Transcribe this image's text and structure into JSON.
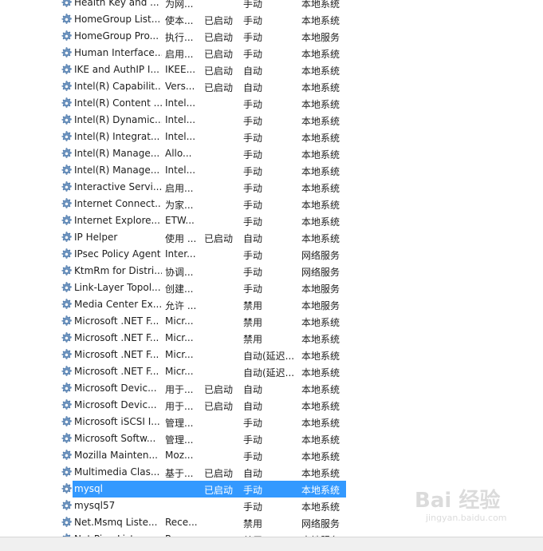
{
  "services": [
    {
      "name": "Health Key and ...",
      "desc": "为网...",
      "status": "",
      "startup": "手动",
      "logon": "本地系统"
    },
    {
      "name": "HomeGroup List...",
      "desc": "使本...",
      "status": "已启动",
      "startup": "手动",
      "logon": "本地系统"
    },
    {
      "name": "HomeGroup Pro...",
      "desc": "执行...",
      "status": "已启动",
      "startup": "手动",
      "logon": "本地服务"
    },
    {
      "name": "Human Interface...",
      "desc": "启用...",
      "status": "已启动",
      "startup": "手动",
      "logon": "本地系统"
    },
    {
      "name": "IKE and AuthIP I...",
      "desc": "IKEE...",
      "status": "已启动",
      "startup": "自动",
      "logon": "本地系统"
    },
    {
      "name": "Intel(R) Capabilit...",
      "desc": "Vers...",
      "status": "已启动",
      "startup": "自动",
      "logon": "本地系统"
    },
    {
      "name": "Intel(R) Content ...",
      "desc": "Intel...",
      "status": "",
      "startup": "手动",
      "logon": "本地系统"
    },
    {
      "name": "Intel(R) Dynamic...",
      "desc": "Intel...",
      "status": "",
      "startup": "手动",
      "logon": "本地系统"
    },
    {
      "name": "Intel(R) Integrat...",
      "desc": "Intel...",
      "status": "",
      "startup": "手动",
      "logon": "本地系统"
    },
    {
      "name": "Intel(R) Manage...",
      "desc": "Allo...",
      "status": "",
      "startup": "手动",
      "logon": "本地系统"
    },
    {
      "name": "Intel(R) Manage...",
      "desc": "Intel...",
      "status": "",
      "startup": "手动",
      "logon": "本地系统"
    },
    {
      "name": "Interactive Servi...",
      "desc": "启用...",
      "status": "",
      "startup": "手动",
      "logon": "本地系统"
    },
    {
      "name": "Internet Connect...",
      "desc": "为家...",
      "status": "",
      "startup": "手动",
      "logon": "本地系统"
    },
    {
      "name": "Internet Explore...",
      "desc": "ETW...",
      "status": "",
      "startup": "手动",
      "logon": "本地系统"
    },
    {
      "name": "IP Helper",
      "desc": "使用 ...",
      "status": "已启动",
      "startup": "自动",
      "logon": "本地系统"
    },
    {
      "name": "IPsec Policy Agent",
      "desc": "Inter...",
      "status": "",
      "startup": "手动",
      "logon": "网络服务"
    },
    {
      "name": "KtmRm for Distri...",
      "desc": "协调...",
      "status": "",
      "startup": "手动",
      "logon": "网络服务"
    },
    {
      "name": "Link-Layer Topol...",
      "desc": "创建...",
      "status": "",
      "startup": "手动",
      "logon": "本地服务"
    },
    {
      "name": "Media Center Ex...",
      "desc": "允许 ...",
      "status": "",
      "startup": "禁用",
      "logon": "本地服务"
    },
    {
      "name": "Microsoft .NET F...",
      "desc": "Micr...",
      "status": "",
      "startup": "禁用",
      "logon": "本地系统"
    },
    {
      "name": "Microsoft .NET F...",
      "desc": "Micr...",
      "status": "",
      "startup": "禁用",
      "logon": "本地系统"
    },
    {
      "name": "Microsoft .NET F...",
      "desc": "Micr...",
      "status": "",
      "startup": "自动(延迟...",
      "logon": "本地系统"
    },
    {
      "name": "Microsoft .NET F...",
      "desc": "Micr...",
      "status": "",
      "startup": "自动(延迟...",
      "logon": "本地系统"
    },
    {
      "name": "Microsoft Devic...",
      "desc": "用于...",
      "status": "已启动",
      "startup": "自动",
      "logon": "本地系统"
    },
    {
      "name": "Microsoft Devic...",
      "desc": "用于...",
      "status": "已启动",
      "startup": "自动",
      "logon": "本地系统"
    },
    {
      "name": "Microsoft iSCSI I...",
      "desc": "管理...",
      "status": "",
      "startup": "手动",
      "logon": "本地系统"
    },
    {
      "name": "Microsoft Softw...",
      "desc": "管理...",
      "status": "",
      "startup": "手动",
      "logon": "本地系统"
    },
    {
      "name": "Mozilla Mainten...",
      "desc": "Moz...",
      "status": "",
      "startup": "手动",
      "logon": "本地系统"
    },
    {
      "name": "Multimedia Clas...",
      "desc": "基于...",
      "status": "已启动",
      "startup": "自动",
      "logon": "本地系统"
    },
    {
      "name": "mysql",
      "desc": "",
      "status": "已启动",
      "startup": "手动",
      "logon": "本地系统",
      "selected": true
    },
    {
      "name": "mysql57",
      "desc": "",
      "status": "",
      "startup": "手动",
      "logon": "本地系统"
    },
    {
      "name": "Net.Msmq Liste...",
      "desc": "Rece...",
      "status": "",
      "startup": "禁用",
      "logon": "网络服务"
    },
    {
      "name": "Net.Pipe Listene...",
      "desc": "Rece...",
      "status": "",
      "startup": "禁用",
      "logon": "本地服务"
    }
  ],
  "icons": {
    "service": "gear-icon"
  },
  "colors": {
    "selection": "#3399ff",
    "gear": "#4a7fb5"
  },
  "watermark": {
    "top": "Bai 经验",
    "bottom": "jingyan.baidu.com"
  }
}
